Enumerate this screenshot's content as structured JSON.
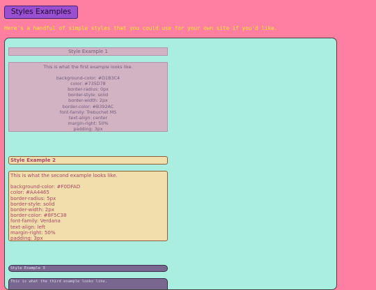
{
  "page": {
    "title": "Styles Examples",
    "intro": "Here's a handful of simple styles that you could use for your own site if you'd like."
  },
  "example1": {
    "heading": "Style Example 1",
    "lines": [
      "This is what the first example looks like.",
      "",
      "background-color: #D1B3C4",
      "color: #735D78",
      "border-radius: 0px",
      "border-style: solid",
      "border-width: 2px",
      "border-color: #B392AC",
      "font-family: Trebuchet MS",
      "text-align: center",
      "margin-right: 50%",
      "padding: 3px"
    ]
  },
  "example2": {
    "heading": "Style Example 2",
    "lines": [
      "This is what the second example looks like.",
      "",
      "background-color: #F0DFAD",
      "color: #AA4465",
      "border-radius: 5px",
      "border-style: solid",
      "border-width: 2px",
      "border-color: #8F5C38",
      "font-family: Verdana",
      "text-align: left",
      "margin-right: 50%",
      "padding: 3px"
    ]
  },
  "example3": {
    "heading": "Style Example 3",
    "lines": [
      "This is what the third example looks like."
    ]
  }
}
